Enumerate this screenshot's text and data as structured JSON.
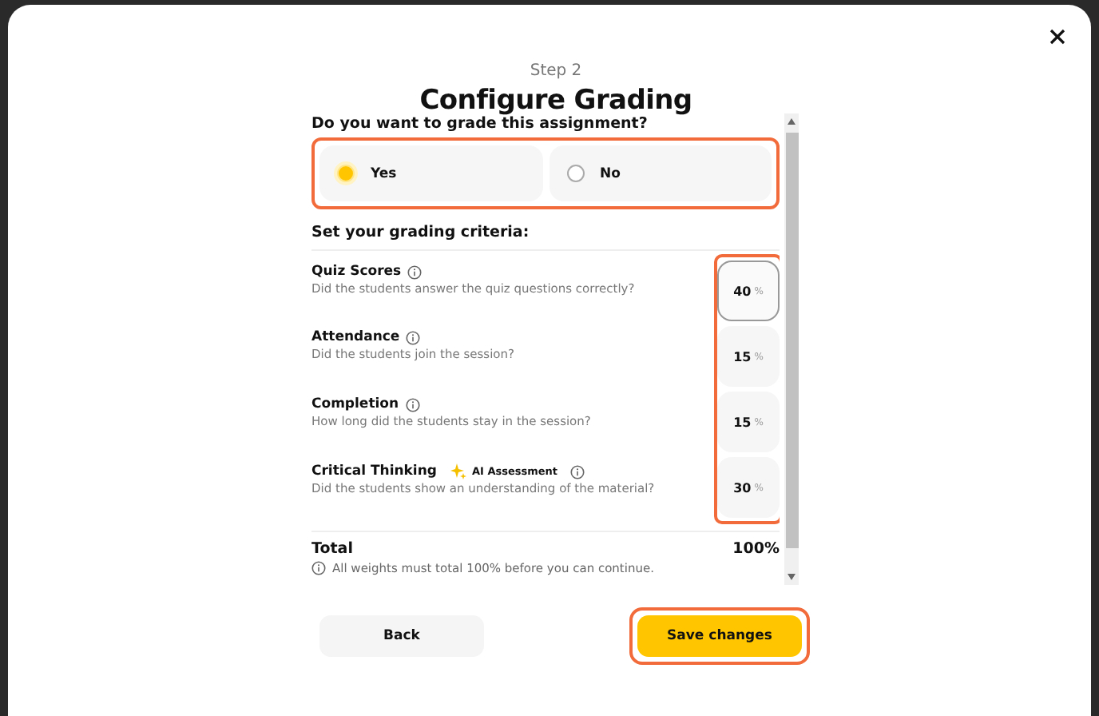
{
  "step": "Step 2",
  "title": "Configure Grading",
  "grade_question": "Do you want to grade this assignment?",
  "grade_options_highlighted": true,
  "grade_options": [
    {
      "label": "Yes",
      "selected": true
    },
    {
      "label": "No",
      "selected": false
    }
  ],
  "criteria_heading": "Set your grading criteria:",
  "criteria_values_highlighted": true,
  "criteria": [
    {
      "name": "Quiz Scores",
      "description": "Did the students answer the quiz questions correctly?",
      "value": "40",
      "unit": "%",
      "focused": true
    },
    {
      "name": "Attendance",
      "description": "Did the students join the session?",
      "value": "15",
      "unit": "%",
      "focused": false
    },
    {
      "name": "Completion",
      "description": "How long did the students stay in the session?",
      "value": "15",
      "unit": "%",
      "focused": false
    },
    {
      "name": "Critical Thinking",
      "badge": "AI Assessment",
      "description": "Did the students show an understanding of the material?",
      "value": "30",
      "unit": "%",
      "focused": false
    }
  ],
  "total": {
    "label": "Total",
    "value": "100%"
  },
  "note": "All weights must total 100% before you can continue.",
  "buttons": [
    {
      "kind": "secondary",
      "label": "Back",
      "highlighted": false
    },
    {
      "kind": "primary",
      "label": "Save changes",
      "highlighted": true
    }
  ]
}
